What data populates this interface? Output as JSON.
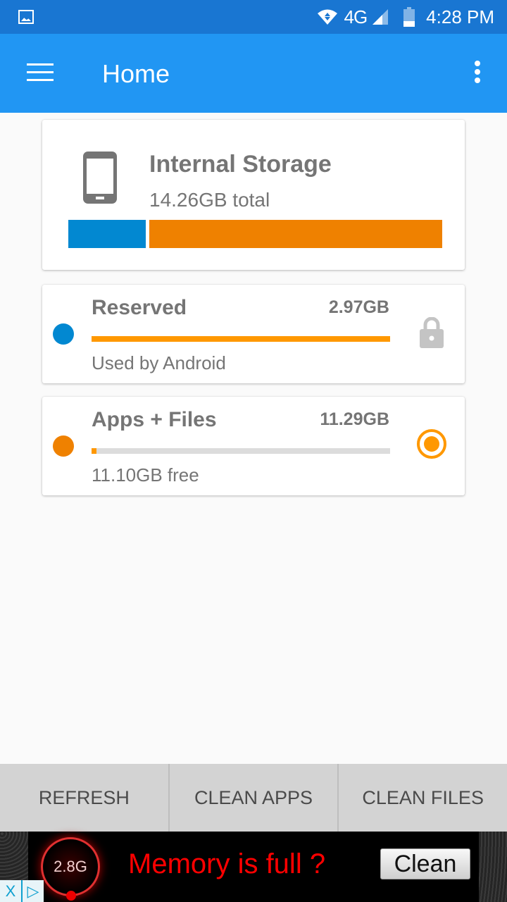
{
  "status_bar": {
    "network": "4G",
    "time": "4:28 PM",
    "icons": [
      "gallery-icon",
      "wifi-icon",
      "signal-icon",
      "battery-icon"
    ]
  },
  "app_bar": {
    "title": "Home",
    "menu_icon": "hamburger-menu-icon",
    "more_icon": "more-vert-icon"
  },
  "storage": {
    "title": "Internal Storage",
    "total": "14.26GB total",
    "total_gb": 14.26,
    "icon": "phone-icon",
    "segments": [
      {
        "name": "Reserved",
        "value_gb": 2.97,
        "color": "#0288d1"
      },
      {
        "name": "Apps + Files",
        "value_gb": 11.29,
        "color": "#ef8100"
      }
    ]
  },
  "items": [
    {
      "title": "Reserved",
      "size": "2.97GB",
      "subtitle": "Used by Android",
      "dot_color": "#0288d1",
      "progress_fraction": 1.0,
      "right_icon": "lock-icon"
    },
    {
      "title": "Apps + Files",
      "size": "11.29GB",
      "subtitle": "11.10GB free",
      "dot_color": "#ef8100",
      "progress_fraction": 0.017,
      "right_icon": "radio-selected-icon"
    }
  ],
  "bottom_actions": [
    {
      "label": "REFRESH"
    },
    {
      "label": "CLEAN APPS"
    },
    {
      "label": "CLEAN FILES"
    }
  ],
  "ad": {
    "gauge_label": "2.8G",
    "headline": "Memory is full ?",
    "button_label": "Clean",
    "close_label": "X",
    "adchoices_label": "▷"
  },
  "colors": {
    "status_bar": "#1976d2",
    "app_bar": "#2196f3",
    "accent_orange": "#ff9800",
    "storage_blue": "#0288d1",
    "storage_orange": "#ef8100"
  }
}
